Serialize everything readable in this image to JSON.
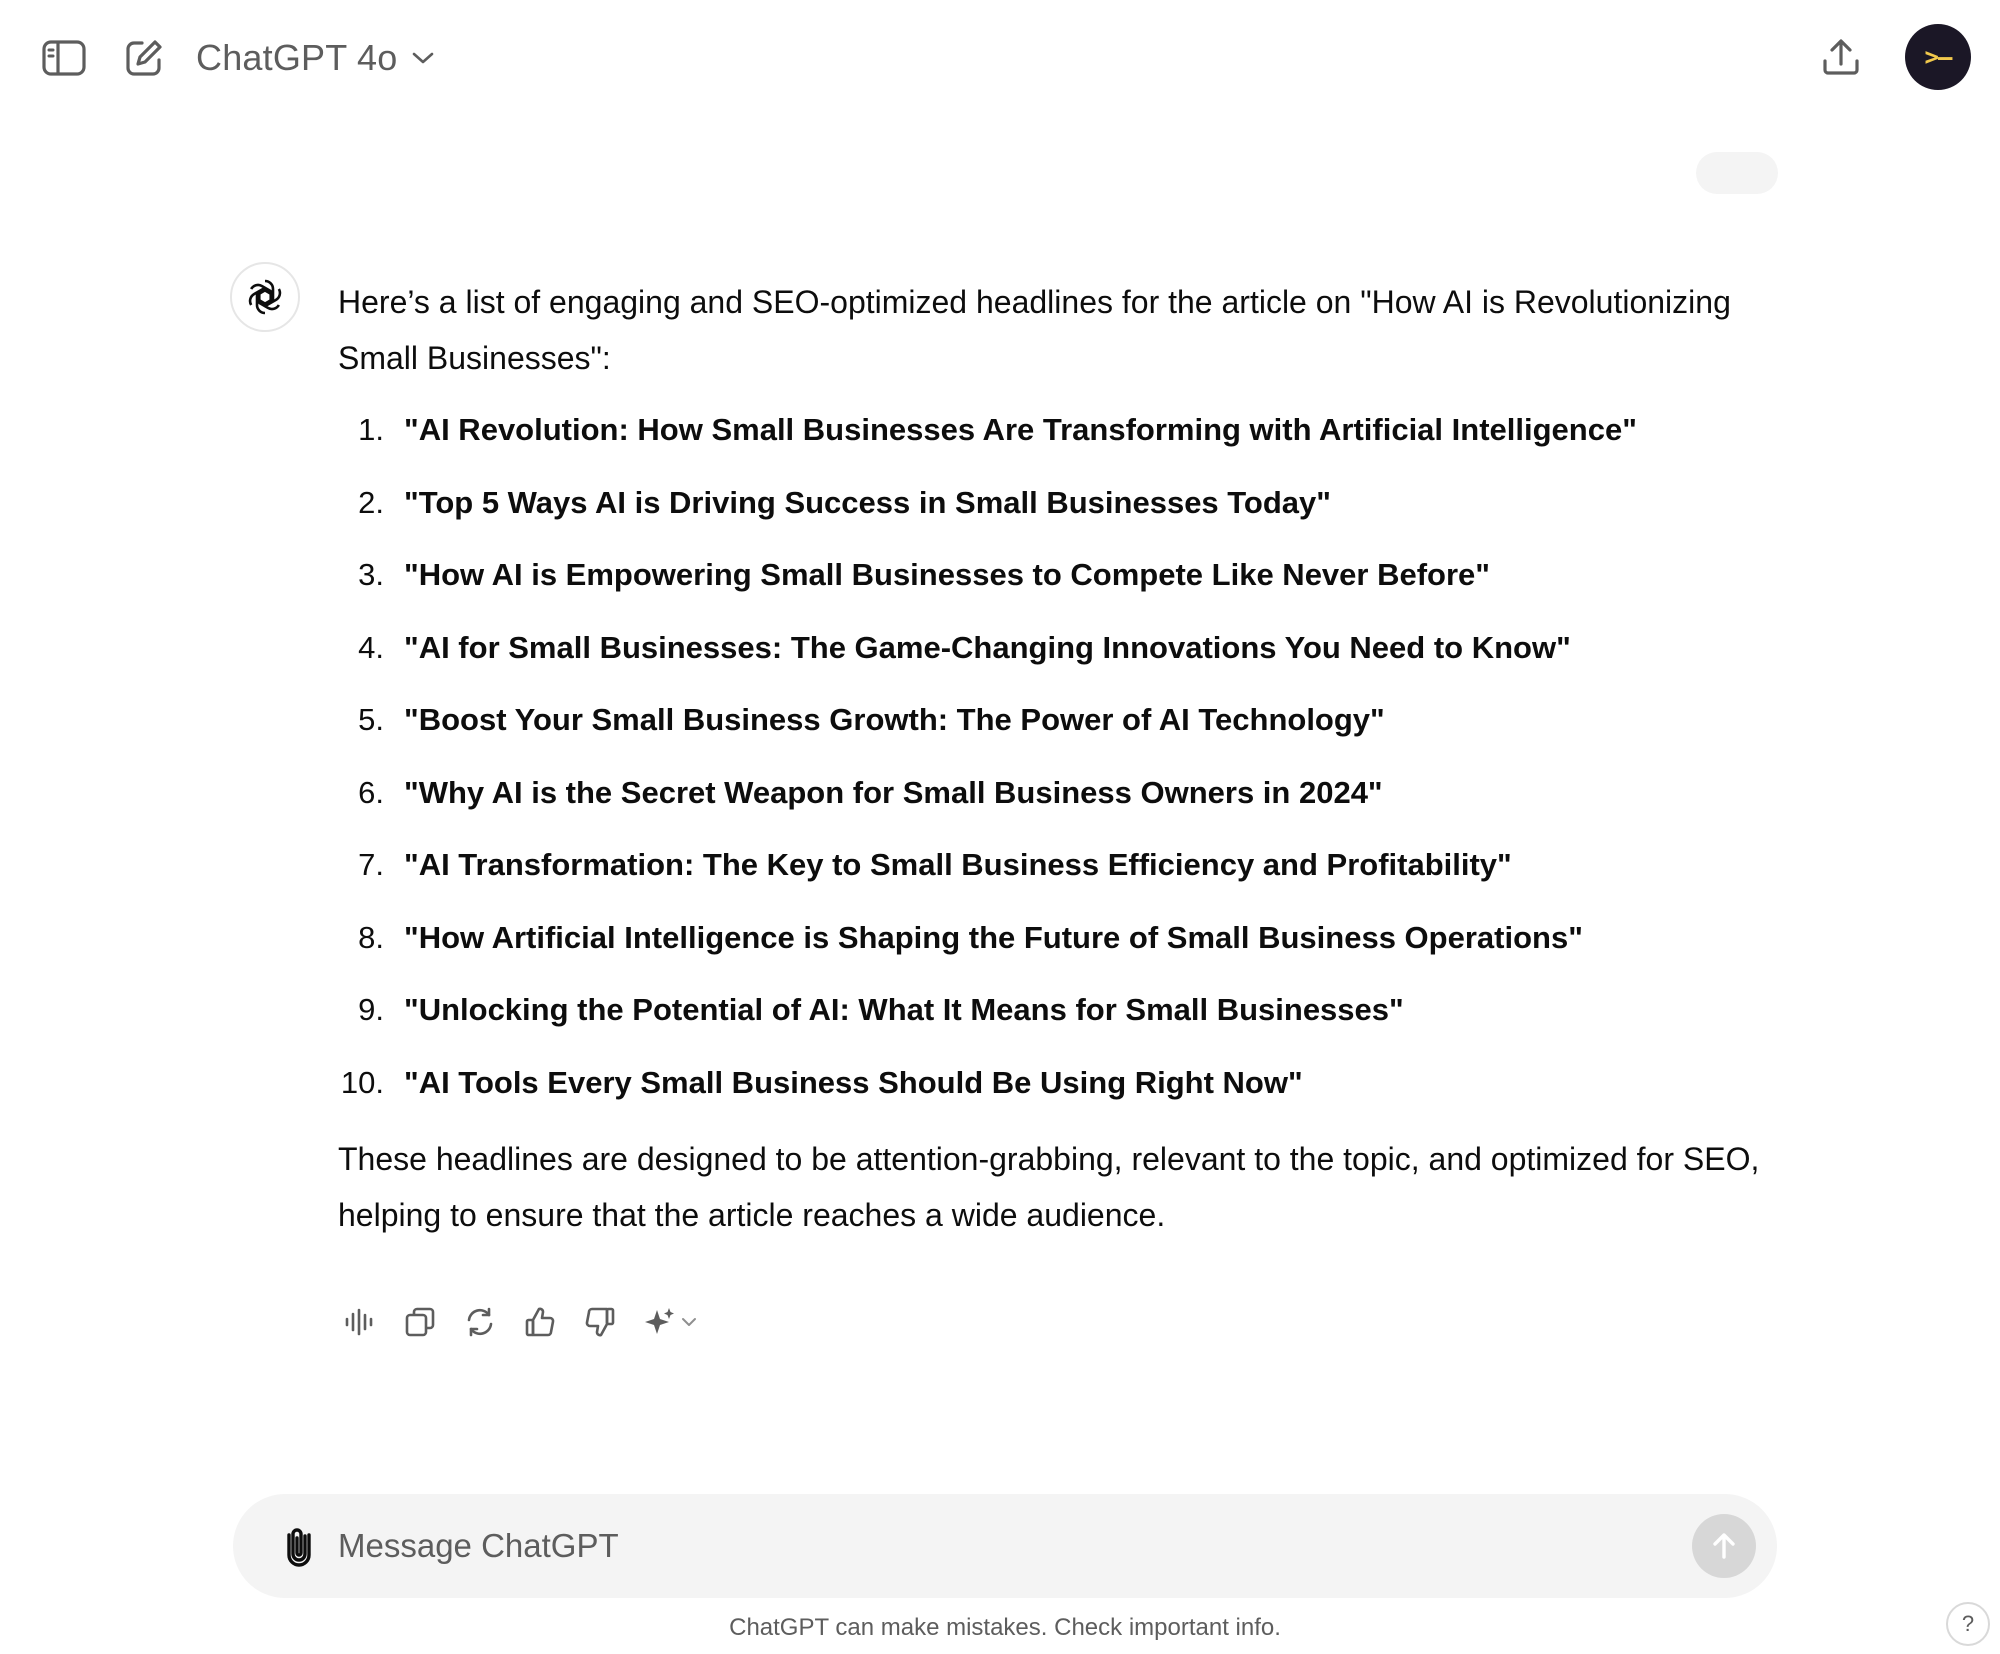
{
  "header": {
    "model_name": "ChatGPT 4o",
    "avatar_glyph": ">–"
  },
  "conversation": {
    "assistant_message": {
      "intro": "Here’s a list of engaging and SEO-optimized headlines for the article on \"How AI is Revolutionizing Small Businesses\":",
      "headlines": [
        {
          "num": "1.",
          "text": "\"AI Revolution: How Small Businesses Are Transforming with Artificial Intelligence\""
        },
        {
          "num": "2.",
          "text": "\"Top 5 Ways AI is Driving Success in Small Businesses Today\""
        },
        {
          "num": "3.",
          "text": "\"How AI is Empowering Small Businesses to Compete Like Never Before\""
        },
        {
          "num": "4.",
          "text": "\"AI for Small Businesses: The Game-Changing Innovations You Need to Know\""
        },
        {
          "num": "5.",
          "text": "\"Boost Your Small Business Growth: The Power of AI Technology\""
        },
        {
          "num": "6.",
          "text": "\"Why AI is the Secret Weapon for Small Business Owners in 2024\""
        },
        {
          "num": "7.",
          "text": "\"AI Transformation: The Key to Small Business Efficiency and Profitability\""
        },
        {
          "num": "8.",
          "text": "\"How Artificial Intelligence is Shaping the Future of Small Business Operations\""
        },
        {
          "num": "9.",
          "text": "\"Unlocking the Potential of AI: What It Means for Small Businesses\""
        },
        {
          "num": "10.",
          "text": "\"AI Tools Every Small Business Should Be Using Right Now\""
        }
      ],
      "outro": "These headlines are designed to be attention-grabbing, relevant to the topic, and optimized for SEO, helping to ensure that the article reaches a wide audience."
    },
    "actions": [
      "read-aloud-icon",
      "copy-icon",
      "regenerate-icon",
      "thumbs-up-icon",
      "thumbs-down-icon",
      "sparkle-icon"
    ]
  },
  "composer": {
    "placeholder": "Message ChatGPT",
    "value": ""
  },
  "footer": {
    "disclaimer": "ChatGPT can make mistakes. Check important info.",
    "help_label": "?"
  },
  "colors": {
    "composer_bg": "#f4f4f4",
    "send_button_disabled": "#d7d7d7",
    "avatar_bg": "#1b1726",
    "avatar_fg": "#f2c94c",
    "muted_text": "#5d5d5d"
  }
}
